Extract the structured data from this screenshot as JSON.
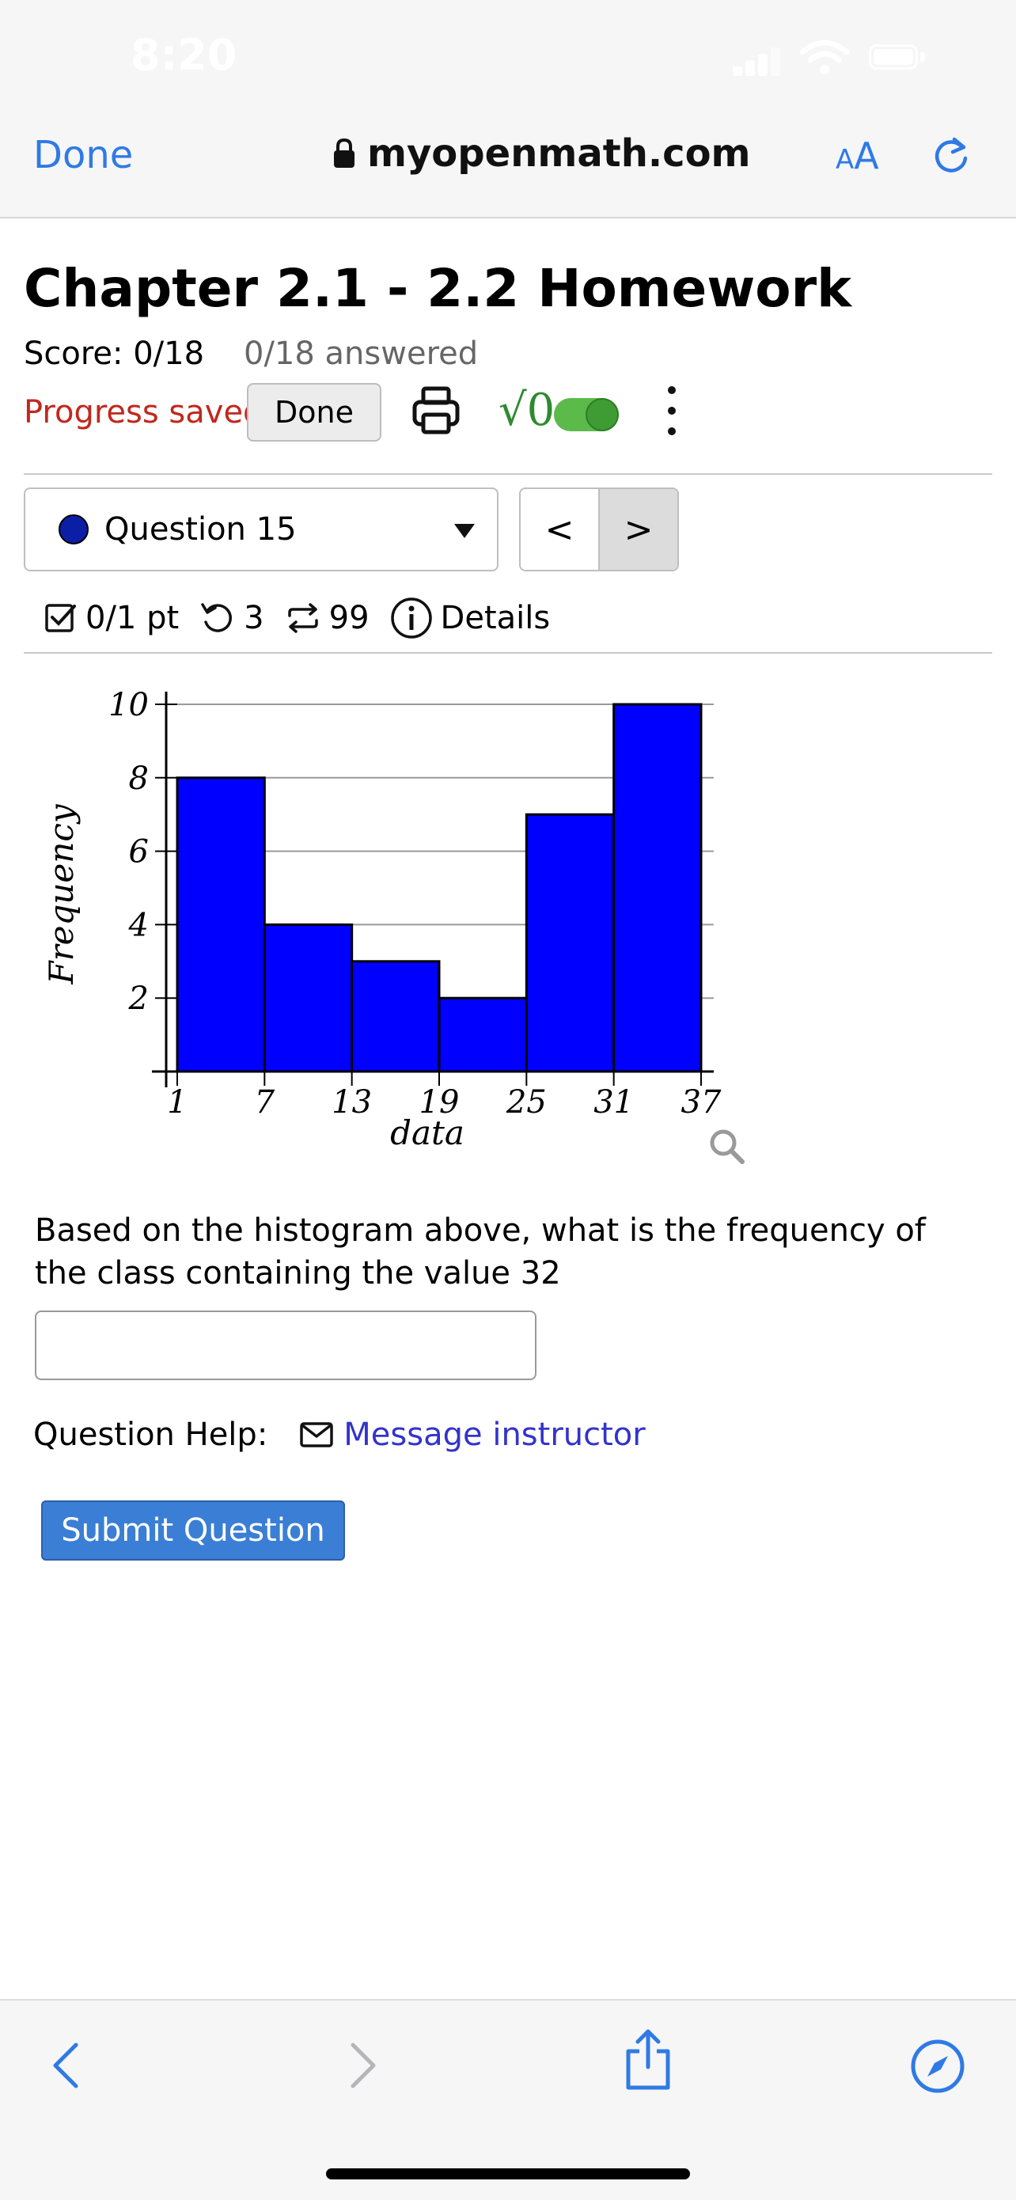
{
  "status_bar": {
    "time": "8:20"
  },
  "browser": {
    "done_label": "Done",
    "url": "myopenmath.com",
    "text_size_label_small": "A",
    "text_size_label_large": "A"
  },
  "assignment": {
    "title": "Chapter 2.1 - 2.2 Homework",
    "score": "Score: 0/18",
    "answered": "0/18 answered",
    "progress": "Progress saved",
    "done_button": "Done",
    "math_icon_text": "√0"
  },
  "question_nav": {
    "selected": "Question 15",
    "prev_symbol": "<",
    "next_symbol": ">"
  },
  "question_meta": {
    "points": "0/1 pt",
    "retries": "3",
    "attempts": "99",
    "details": "Details"
  },
  "chart_data": {
    "type": "bar",
    "categories": [
      "1-7",
      "7-13",
      "13-19",
      "19-25",
      "25-31",
      "31-37"
    ],
    "bin_edges": [
      1,
      7,
      13,
      19,
      25,
      31,
      37
    ],
    "values": [
      8,
      4,
      3,
      2,
      7,
      10
    ],
    "xlabel": "data",
    "ylabel": "Frequency",
    "ylim": [
      0,
      10
    ],
    "yticks": [
      2,
      4,
      6,
      8,
      10
    ],
    "xticks": [
      1,
      7,
      13,
      19,
      25,
      31,
      37
    ],
    "grid": true,
    "bar_color": "#0000ff"
  },
  "prompt": "Based on the histogram above, what is the frequency of the class containing the value 32",
  "answer": {
    "value": "",
    "placeholder": ""
  },
  "help": {
    "label": "Question Help:",
    "message_link": "Message instructor"
  },
  "submit_label": "Submit Question",
  "colors": {
    "link": "#2f7ae5",
    "progress": "#c0281e",
    "submit": "#3a7fd5",
    "toggle": "#5cba4a"
  }
}
